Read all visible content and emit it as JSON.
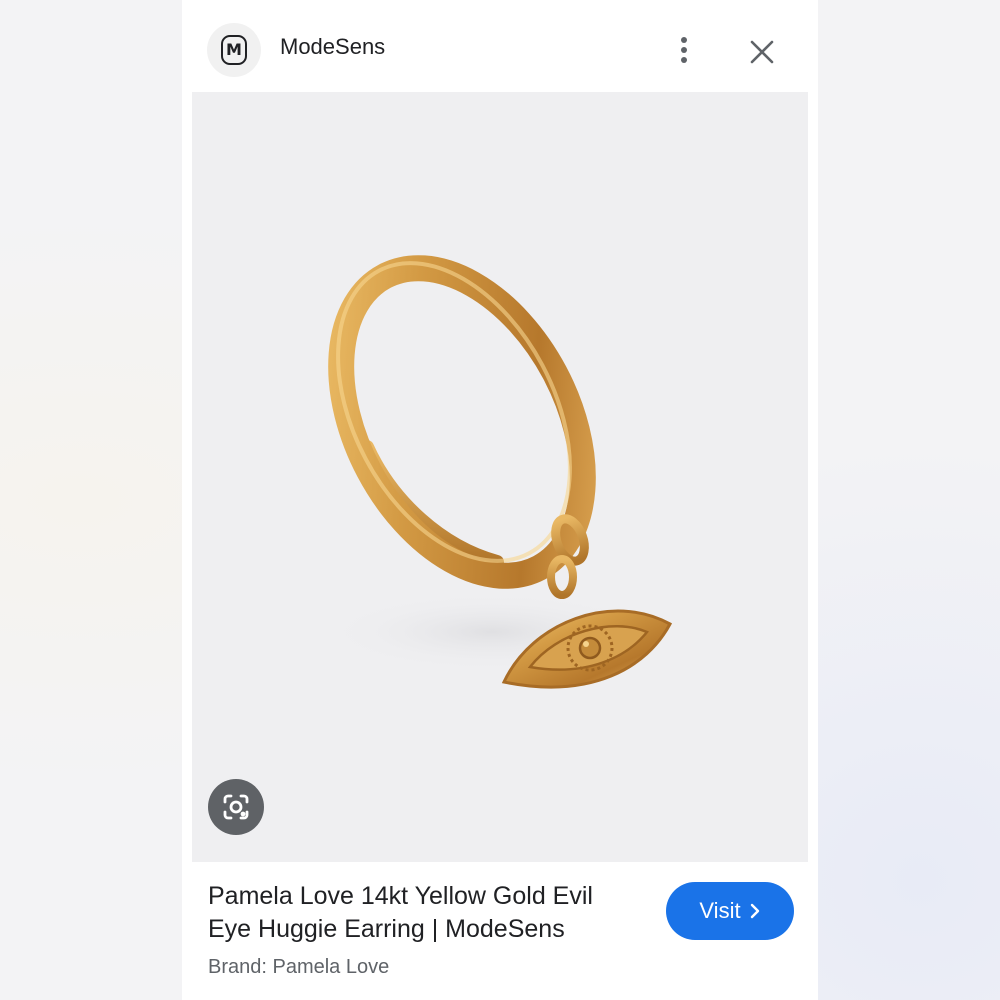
{
  "header": {
    "logo_letter": "M",
    "site_name": "ModeSens"
  },
  "icons": {
    "logo": "modesens-logo-icon",
    "menu": "more-vert-icon",
    "close": "close-icon",
    "lens": "google-lens-icon",
    "chevron": "chevron-right-icon"
  },
  "product": {
    "title": "Pamela Love 14kt Yellow Gold Evil Eye Huggie Earring | ModeSens",
    "brand": "Brand: Pamela Love",
    "image_subject": "gold-hoop-earring-with-evil-eye-charm"
  },
  "actions": {
    "visit_label": "Visit"
  },
  "colors": {
    "accent": "#1a73e8",
    "gold": "#c9913a",
    "image_bg": "#efeff1"
  }
}
